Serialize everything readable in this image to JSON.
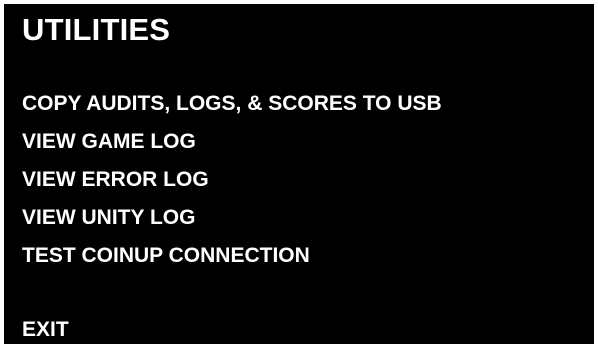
{
  "screen": {
    "title": "UTILITIES",
    "background_color": "#000000",
    "text_color": "#ffffff"
  },
  "menu": {
    "items": [
      {
        "label": "COPY AUDITS, LOGS, & SCORES TO USB"
      },
      {
        "label": "VIEW GAME LOG"
      },
      {
        "label": "VIEW ERROR LOG"
      },
      {
        "label": "VIEW UNITY LOG"
      },
      {
        "label": "TEST COINUP CONNECTION"
      }
    ],
    "exit_label": "EXIT"
  }
}
